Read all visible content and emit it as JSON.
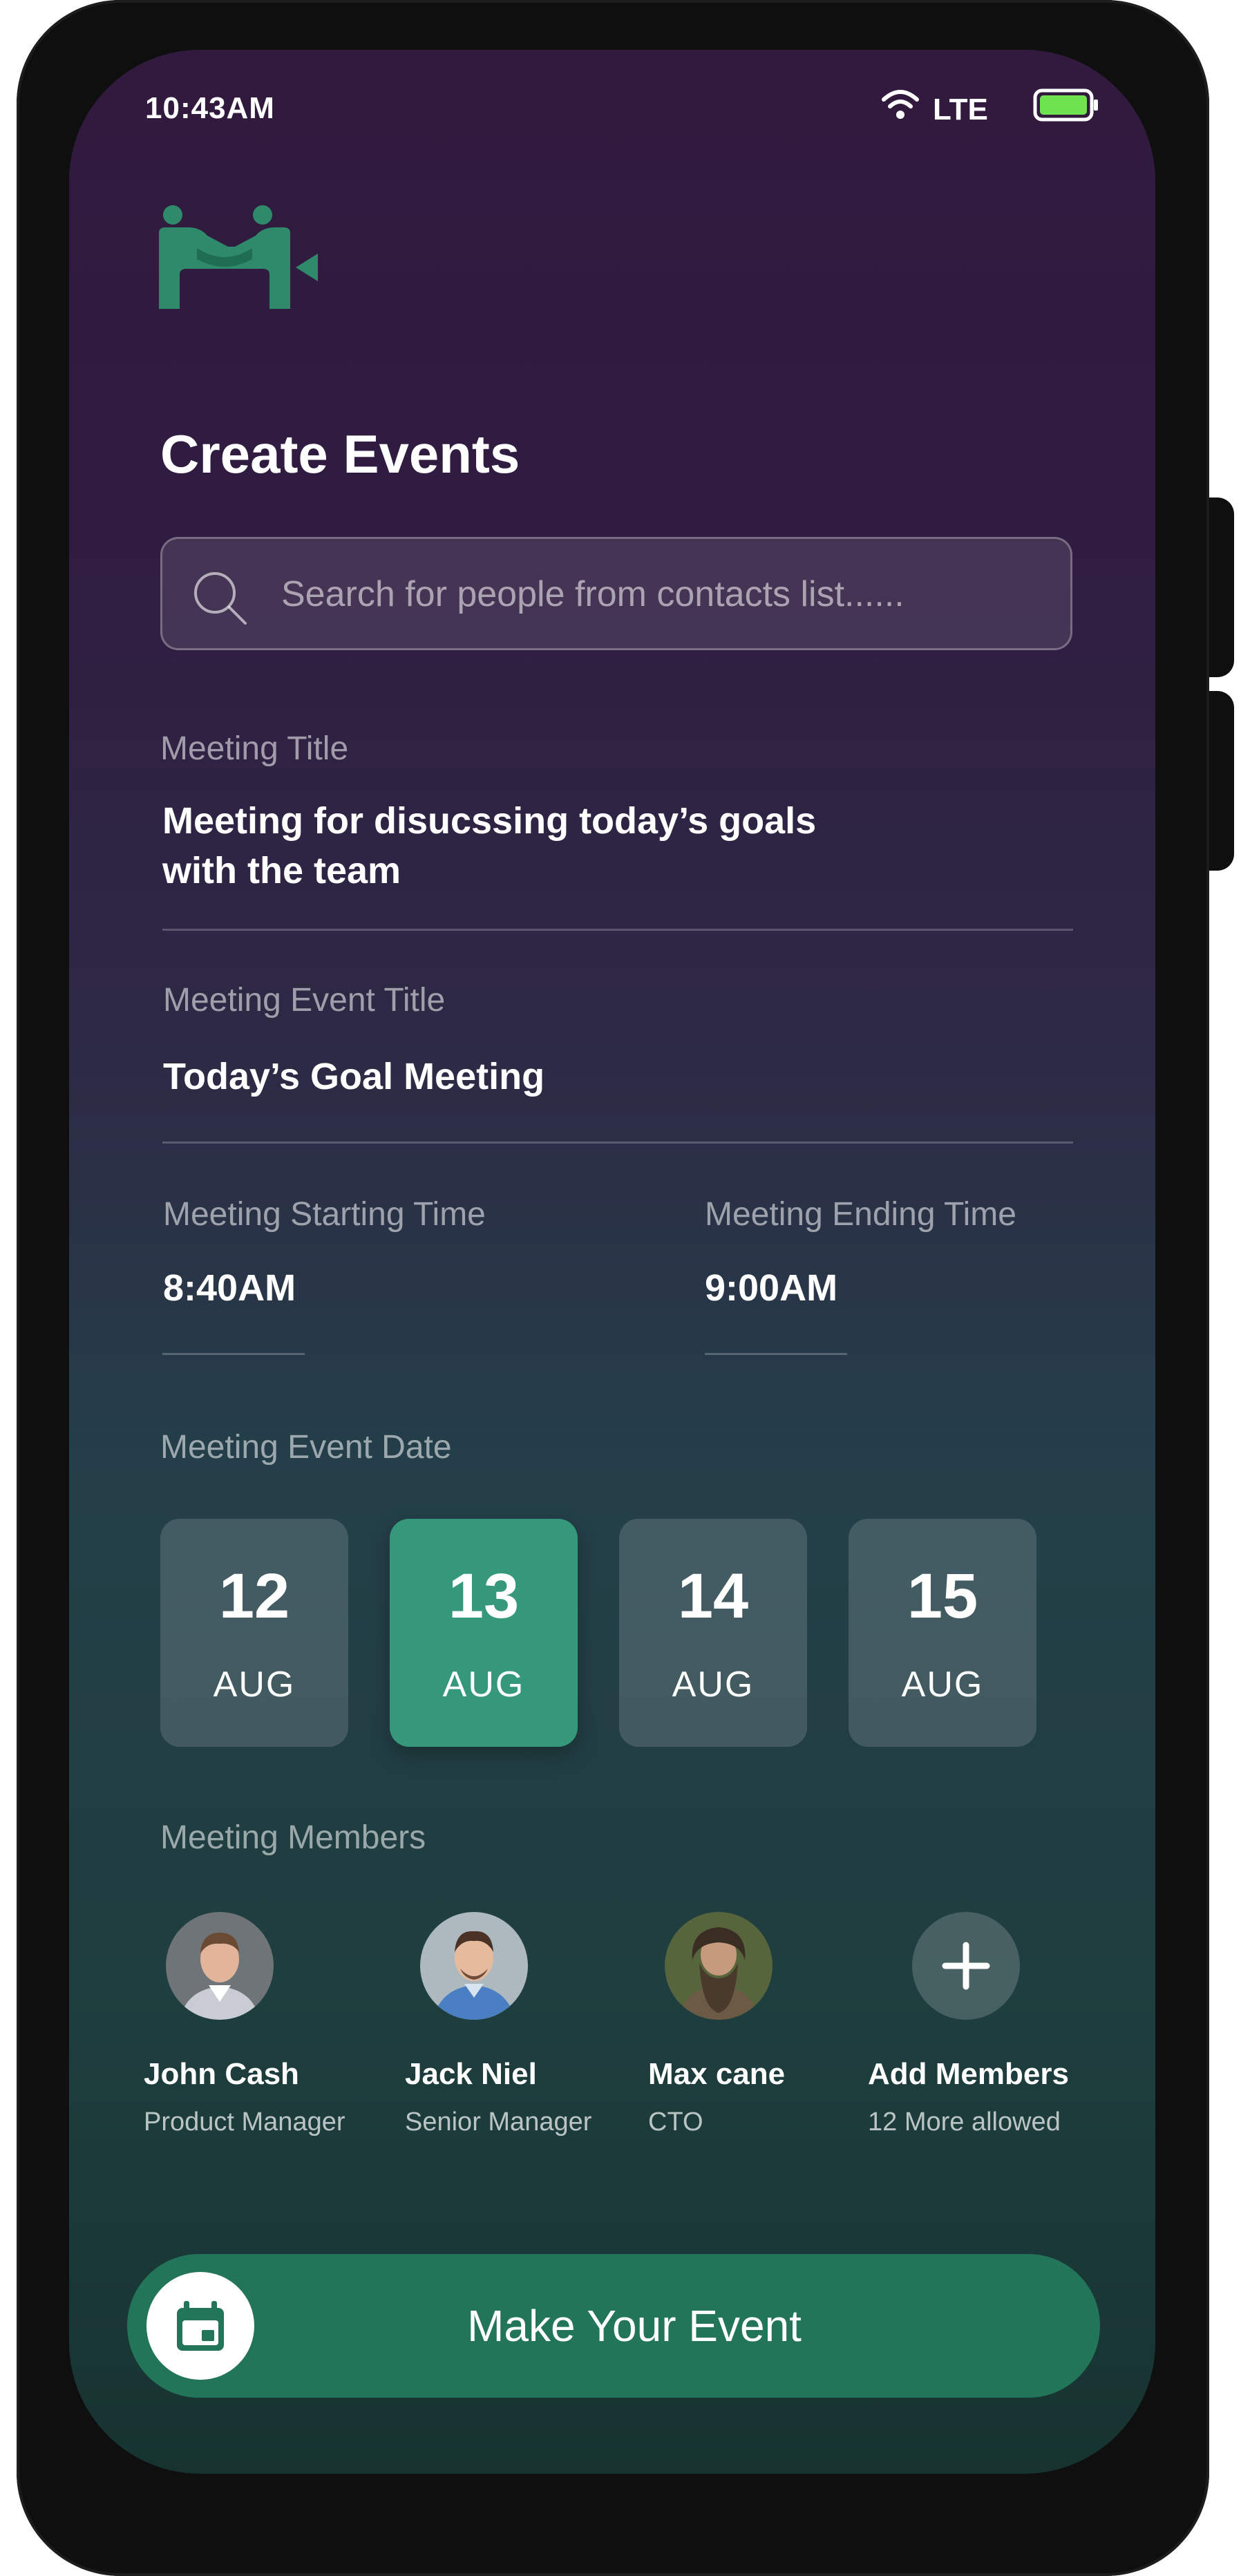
{
  "status_bar": {
    "time": "10:43AM",
    "network": "LTE"
  },
  "page": {
    "title": "Create Events",
    "search_placeholder": "Search for people from contacts list......"
  },
  "form": {
    "meeting_title": {
      "label": "Meeting Title",
      "line1": "Meeting for disucssing today’s goals",
      "line2": "with the team"
    },
    "event_title": {
      "label": "Meeting Event Title",
      "value": "Today’s Goal Meeting"
    },
    "start_time": {
      "label": "Meeting Starting Time",
      "value": "8:40AM"
    },
    "end_time": {
      "label": "Meeting Ending Time",
      "value": "9:00AM"
    },
    "date": {
      "label": "Meeting Event Date",
      "options": [
        {
          "day": "12",
          "month": "AUG",
          "selected": false
        },
        {
          "day": "13",
          "month": "AUG",
          "selected": true
        },
        {
          "day": "14",
          "month": "AUG",
          "selected": false
        },
        {
          "day": "15",
          "month": "AUG",
          "selected": false
        }
      ]
    }
  },
  "members": {
    "label": "Meeting Members",
    "list": [
      {
        "name": "John Cash",
        "role": "Product Manager"
      },
      {
        "name": "Jack Niel",
        "role": "Senior Manager"
      },
      {
        "name": "Max cane",
        "role": "CTO"
      }
    ],
    "add": {
      "name": "Add Members",
      "note": "12 More allowed"
    }
  },
  "cta": {
    "label": "Make Your Event"
  },
  "colors": {
    "accent": "#35987b",
    "button": "#237559",
    "logo": "#2f8a6b"
  },
  "icons": [
    "wifi-icon",
    "battery-icon",
    "logo-icon",
    "search-icon",
    "plus-icon",
    "calendar-icon"
  ]
}
